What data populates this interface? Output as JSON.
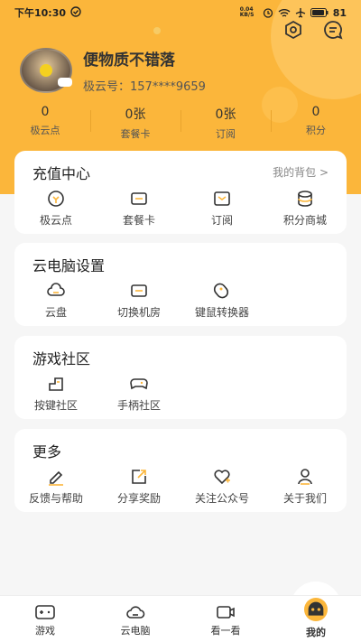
{
  "status_bar": {
    "time": "下午10:30",
    "net_speed": "0.04 KB/S",
    "battery": "81"
  },
  "profile": {
    "username": "便物质不错落",
    "uid_label": "极云号：",
    "uid": "157****9659"
  },
  "stats": [
    {
      "value": "0",
      "label": "极云点"
    },
    {
      "value": "0张",
      "label": "套餐卡"
    },
    {
      "value": "0张",
      "label": "订阅"
    },
    {
      "value": "0",
      "label": "积分"
    }
  ],
  "recharge": {
    "title": "充值中心",
    "link": "我的背包 >",
    "items": [
      {
        "label": "极云点",
        "icon": "coin-icon"
      },
      {
        "label": "套餐卡",
        "icon": "card-icon"
      },
      {
        "label": "订阅",
        "icon": "subscribe-icon"
      },
      {
        "label": "积分商城",
        "icon": "points-icon"
      }
    ]
  },
  "cloud_settings": {
    "title": "云电脑设置",
    "items": [
      {
        "label": "云盘",
        "icon": "cloud-disk-icon"
      },
      {
        "label": "切换机房",
        "icon": "server-switch-icon"
      },
      {
        "label": "键鼠转换器",
        "icon": "mouse-icon"
      }
    ]
  },
  "community": {
    "title": "游戏社区",
    "items": [
      {
        "label": "按键社区",
        "icon": "key-icon"
      },
      {
        "label": "手柄社区",
        "icon": "gamepad-icon"
      }
    ]
  },
  "more": {
    "title": "更多",
    "items": [
      {
        "label": "反馈与帮助",
        "icon": "edit-icon"
      },
      {
        "label": "分享奖励",
        "icon": "share-icon"
      },
      {
        "label": "关注公众号",
        "icon": "heart-icon"
      },
      {
        "label": "关于我们",
        "icon": "user-icon"
      }
    ]
  },
  "tabbar": [
    {
      "label": "游戏",
      "icon": "controller-icon"
    },
    {
      "label": "云电脑",
      "icon": "cloud-icon"
    },
    {
      "label": "看一看",
      "icon": "video-icon"
    },
    {
      "label": "我的",
      "icon": "me-icon"
    }
  ],
  "colors": {
    "accent": "#fbb63b",
    "background": "#f6f6f6"
  }
}
